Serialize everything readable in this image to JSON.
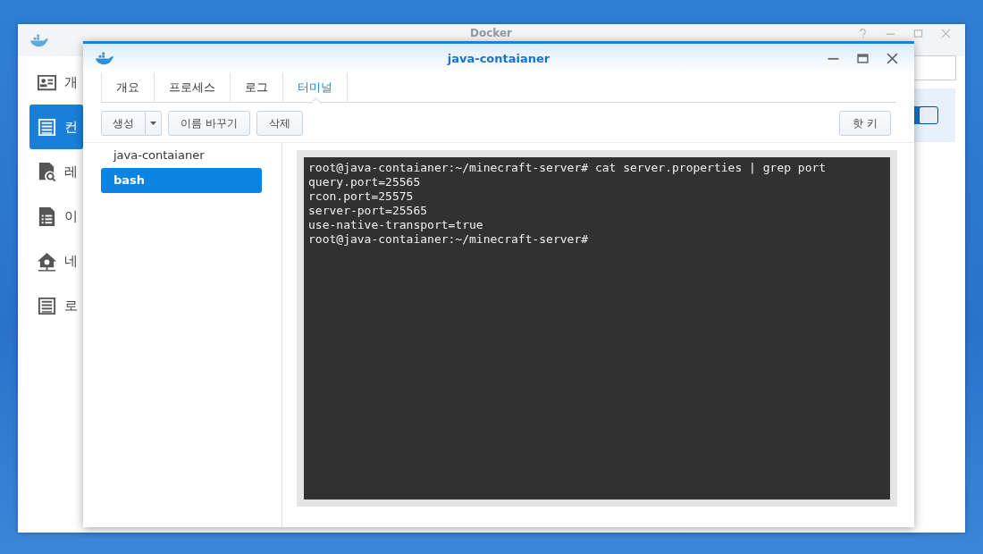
{
  "back_window": {
    "title": "Docker",
    "sidebar": [
      {
        "label": "개",
        "kind": "card",
        "selected": false
      },
      {
        "label": "컨",
        "kind": "list",
        "selected": true
      },
      {
        "label": "레",
        "kind": "search",
        "selected": false
      },
      {
        "label": "이",
        "kind": "doc",
        "selected": false
      },
      {
        "label": "네",
        "kind": "house",
        "selected": false
      },
      {
        "label": "로",
        "kind": "list",
        "selected": false
      }
    ],
    "toggle": {
      "on": true
    }
  },
  "window": {
    "title": "java-contaianer",
    "tabs": [
      {
        "label": "개요",
        "selected": false
      },
      {
        "label": "프로세스",
        "selected": false
      },
      {
        "label": "로그",
        "selected": false
      },
      {
        "label": "터미널",
        "selected": true
      }
    ],
    "toolbar": {
      "create": "생성",
      "rename": "이름 바꾸기",
      "delete": "삭제",
      "hotkey": "핫 키"
    },
    "sessions": {
      "container": "java-contaianer",
      "items": [
        {
          "label": "bash",
          "selected": true
        }
      ]
    },
    "terminal": {
      "lines": [
        "root@java-contaianer:~/minecraft-server# cat server.properties | grep port",
        "query.port=25565",
        "rcon.port=25575",
        "server-port=25565",
        "use-native-transport=true",
        "root@java-contaianer:~/minecraft-server#"
      ]
    }
  }
}
